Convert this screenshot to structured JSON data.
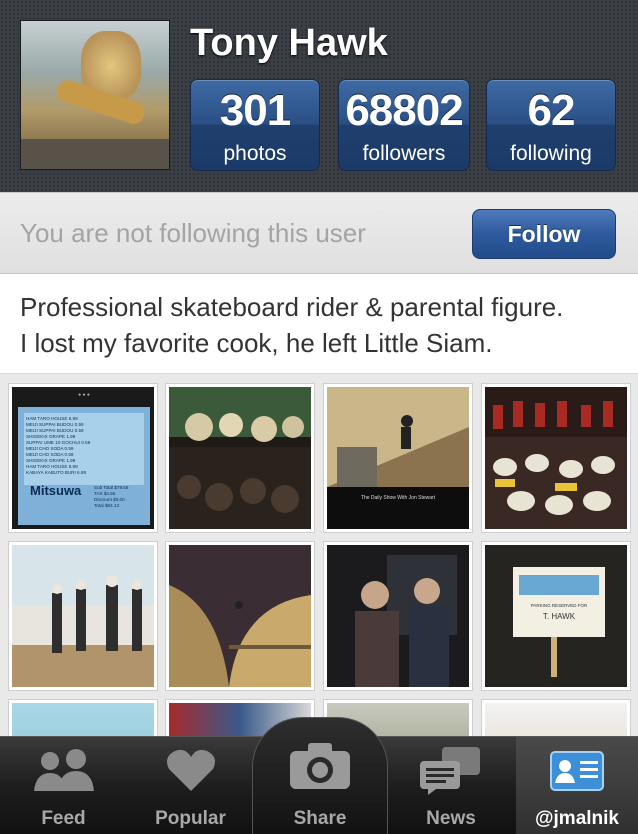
{
  "profile": {
    "name": "Tony Hawk",
    "stats": [
      {
        "value": "301",
        "label": "photos"
      },
      {
        "value": "68802",
        "label": "followers"
      },
      {
        "value": "62",
        "label": "following"
      }
    ]
  },
  "follow": {
    "status_text": "You are not following this user",
    "button_label": "Follow"
  },
  "bio": {
    "line1": "Professional skateboard rider & parental figure.",
    "line2": "I lost my favorite cook, he left Little Siam."
  },
  "receipt": {
    "brand": "Mitsuwa",
    "lines": [
      "HAM TARO HOUSE 6.99",
      "MEIJI SUPPAI BUDOU 0.59",
      "MEIJI SUPPAI BUDOU 0.59",
      "SHIGEKIX GRAPE 1.99",
      "SUPPAI UME 10 GOCHUI 0.59",
      "MEIJI CHO SODA 0.59",
      "MEIJI CHO SODA 0.59",
      "SHIGEKIX GRAPE 1.99",
      "HAM TARO HOUSE 6.99",
      "KABAYA KABUTO BURI 6.99"
    ],
    "totals": [
      "Sub Total $79.56",
      "TAX $4.56",
      "Discount $0.00",
      "Total $84.13"
    ]
  },
  "tv_caption": "The Daily Show With Jon Stewart",
  "parking_sign": {
    "line": "PARKING RESERVED FOR",
    "name": "T. HAWK"
  },
  "tabs": [
    {
      "label": "Feed",
      "icon": "people-icon"
    },
    {
      "label": "Popular",
      "icon": "heart-icon"
    },
    {
      "label": "Share",
      "icon": "camera-icon"
    },
    {
      "label": "News",
      "icon": "chat-bubbles-icon"
    },
    {
      "label": "@jmalnik",
      "icon": "profile-card-icon"
    }
  ],
  "colors": {
    "accent": "#2a4f85",
    "header_bg": "#3a3f45"
  }
}
